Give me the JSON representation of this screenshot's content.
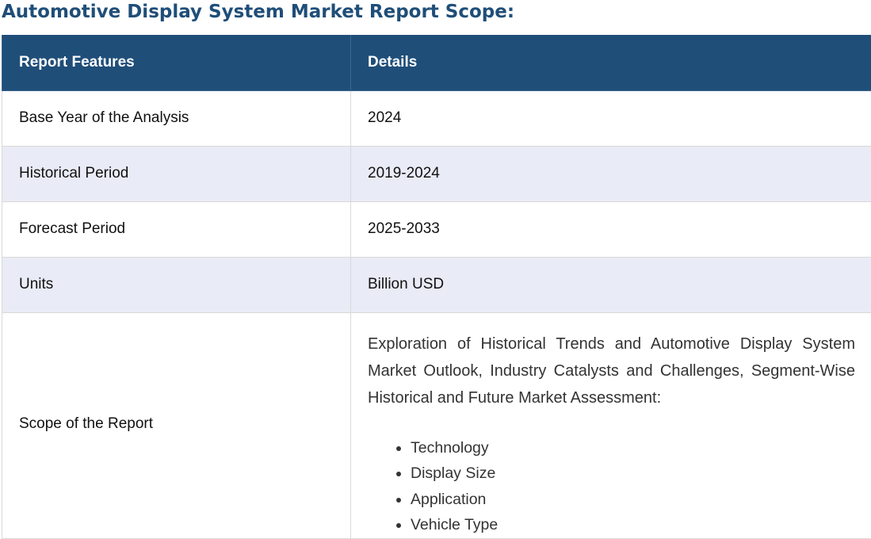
{
  "title": "Automotive Display System Market Report Scope:",
  "table": {
    "headers": [
      "Report Features",
      "Details"
    ],
    "rows": [
      {
        "feature": "Base Year of the Analysis",
        "detail": "2024"
      },
      {
        "feature": "Historical Period",
        "detail": "2019-2024"
      },
      {
        "feature": "Forecast Period",
        "detail": "2025-2033"
      },
      {
        "feature": "Units",
        "detail": "Billion USD"
      }
    ],
    "scope_row": {
      "feature": "Scope of the Report",
      "description": "Exploration of Historical Trends and Automotive Display System Market Outlook, Industry Catalysts and Challenges, Segment-Wise Historical and Future Market Assessment:",
      "segments": [
        "Technology",
        "Display Size",
        "Application",
        "Vehicle Type"
      ]
    }
  },
  "colors": {
    "title": "#1f4e79",
    "header_bg": "#1f4e79",
    "alt_row_bg": "#e9ebf6"
  }
}
